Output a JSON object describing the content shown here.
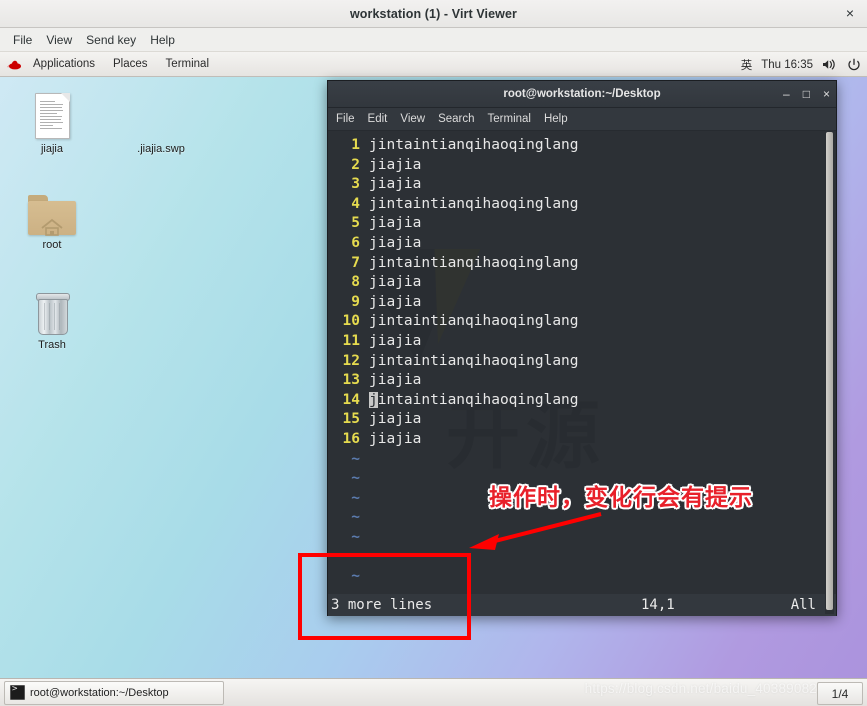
{
  "viewer": {
    "title": "workstation (1) - Virt Viewer",
    "close_label": "×",
    "menu": [
      "File",
      "View",
      "Send key",
      "Help"
    ]
  },
  "gnome_panel": {
    "logo": "redhat-logo",
    "items": [
      "Applications",
      "Places",
      "Terminal"
    ],
    "input_method": "英",
    "clock": "Thu 16:35",
    "volume_icon": "volume-icon",
    "power_icon": "power-icon"
  },
  "desktop": {
    "icons": [
      {
        "label": "jiajia",
        "icon": "document-icon"
      },
      {
        "label": ".jiajia.swp",
        "icon": "none"
      },
      {
        "label": "root",
        "icon": "home-folder-icon"
      },
      {
        "label": "Trash",
        "icon": "trash-icon"
      }
    ]
  },
  "terminal": {
    "title": "root@workstation:~/Desktop",
    "minimize_label": "–",
    "maximize_label": "□",
    "close_label": "×",
    "menu": [
      "File",
      "Edit",
      "View",
      "Search",
      "Terminal",
      "Help"
    ],
    "background_watermark": "开源",
    "lines": [
      {
        "num": "1",
        "text": "jintaintianqihaoqinglang"
      },
      {
        "num": "2",
        "text": "jiajia"
      },
      {
        "num": "3",
        "text": "jiajia"
      },
      {
        "num": "4",
        "text": "jintaintianqihaoqinglang"
      },
      {
        "num": "5",
        "text": "jiajia"
      },
      {
        "num": "6",
        "text": "jiajia"
      },
      {
        "num": "7",
        "text": "jintaintianqihaoqinglang"
      },
      {
        "num": "8",
        "text": "jiajia"
      },
      {
        "num": "9",
        "text": "jiajia"
      },
      {
        "num": "10",
        "text": "jintaintianqihaoqinglang"
      },
      {
        "num": "11",
        "text": "jiajia"
      },
      {
        "num": "12",
        "text": "jintaintianqihaoqinglang"
      },
      {
        "num": "13",
        "text": "jiajia"
      },
      {
        "num": "14",
        "text": "jintaintianqihaoqinglang",
        "cursor": true
      },
      {
        "num": "15",
        "text": "jiajia"
      },
      {
        "num": "16",
        "text": "jiajia"
      }
    ],
    "tilde_count": 7,
    "tilde_char": "~",
    "status": {
      "message": "3 more lines",
      "position": "14,1",
      "scroll": "All"
    }
  },
  "annotation": {
    "text": "操作时，变化行会有提示",
    "color": "#e8202a",
    "box_color": "#ff0000"
  },
  "taskbar": {
    "window_label": "root@workstation:~/Desktop",
    "window_icon": "terminal-icon",
    "workspace": "1/4"
  },
  "watermark": {
    "url": "https://blog.csdn.net/baidu_40389082"
  }
}
